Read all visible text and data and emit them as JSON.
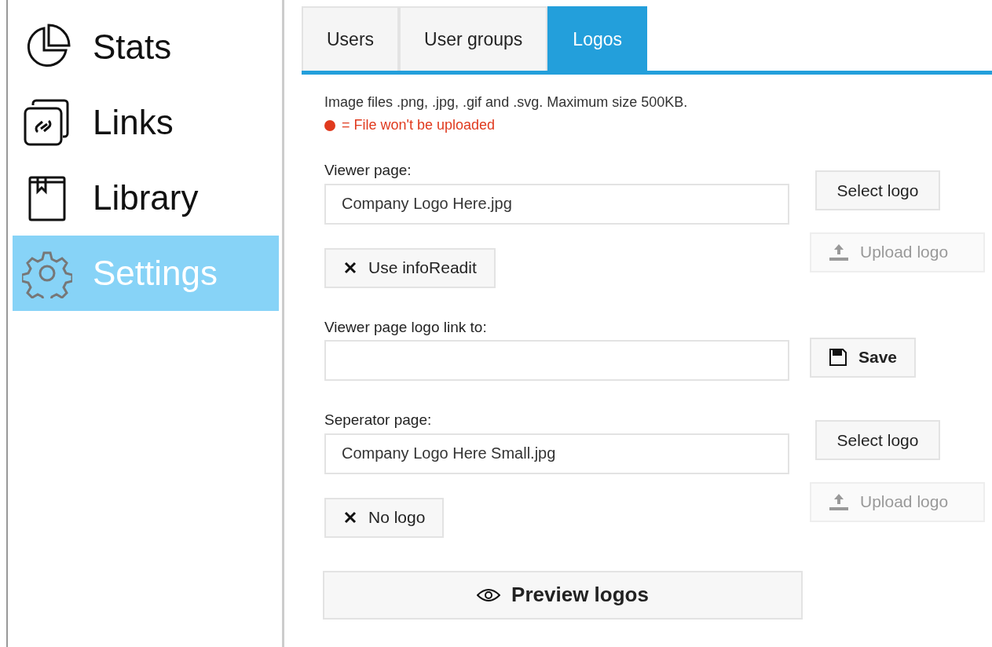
{
  "sidebar": {
    "items": [
      {
        "label": "Stats",
        "selected": false
      },
      {
        "label": "Links",
        "selected": false
      },
      {
        "label": "Library",
        "selected": false
      },
      {
        "label": "Settings",
        "selected": true
      }
    ]
  },
  "tabs": [
    {
      "label": "Users",
      "selected": false
    },
    {
      "label": "User groups",
      "selected": false
    },
    {
      "label": "Logos",
      "selected": true
    }
  ],
  "notice": {
    "text": "Image files .png, .jpg, .gif and .svg. Maximum size 500KB.",
    "legend": "= File won't be uploaded"
  },
  "sections": [
    {
      "kind": "logo",
      "label": "Viewer page:",
      "value": "Company Logo Here.jpg",
      "select_button": "Select logo",
      "clear_button": "Use infoReadit",
      "upload_button": {
        "label": "Upload logo",
        "disabled": true
      }
    },
    {
      "kind": "link",
      "label": "Viewer page logo link to:",
      "save_button": "Save"
    },
    {
      "kind": "logo",
      "label": "Seperator page:",
      "value": "Company Logo Here Small.jpg",
      "select_button": "Select logo",
      "clear_button": "No logo",
      "upload_button": {
        "label": "Upload logo",
        "disabled": true
      }
    }
  ],
  "preview_button": "Preview logos"
}
